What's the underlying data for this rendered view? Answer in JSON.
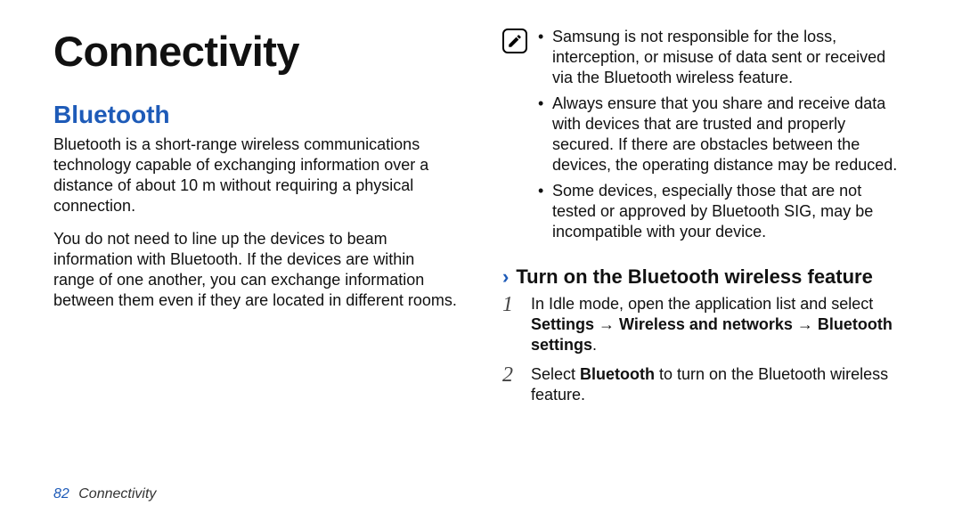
{
  "title": "Connectivity",
  "section": "Bluetooth",
  "paragraphs": [
    "Bluetooth is a short-range wireless communications technology capable of exchanging information over a distance of about 10 m without requiring a physical connection.",
    "You do not need to line up the devices to beam information with Bluetooth. If the devices are within range of one another, you can exchange information between them even if they are located in different rooms."
  ],
  "note_icon": "note-pencil-icon",
  "notes": [
    "Samsung is not responsible for the loss, interception, or misuse of data sent or received via the Bluetooth wireless feature.",
    "Always ensure that you share and receive data with devices that are trusted and properly secured. If there are obstacles between the devices, the operating distance may be reduced.",
    "Some devices, especially those that are not tested or approved by Bluetooth SIG, may be incompatible with your device."
  ],
  "subheading": "Turn on the Bluetooth wireless feature",
  "steps": [
    {
      "num": "1",
      "pre": "In Idle mode, open the application list and select ",
      "bold": "Settings → Wireless and networks → Bluetooth settings",
      "post": "."
    },
    {
      "num": "2",
      "pre": "Select ",
      "bold": "Bluetooth",
      "post": " to turn on the Bluetooth wireless feature."
    }
  ],
  "footer": {
    "page": "82",
    "label": "Connectivity"
  }
}
